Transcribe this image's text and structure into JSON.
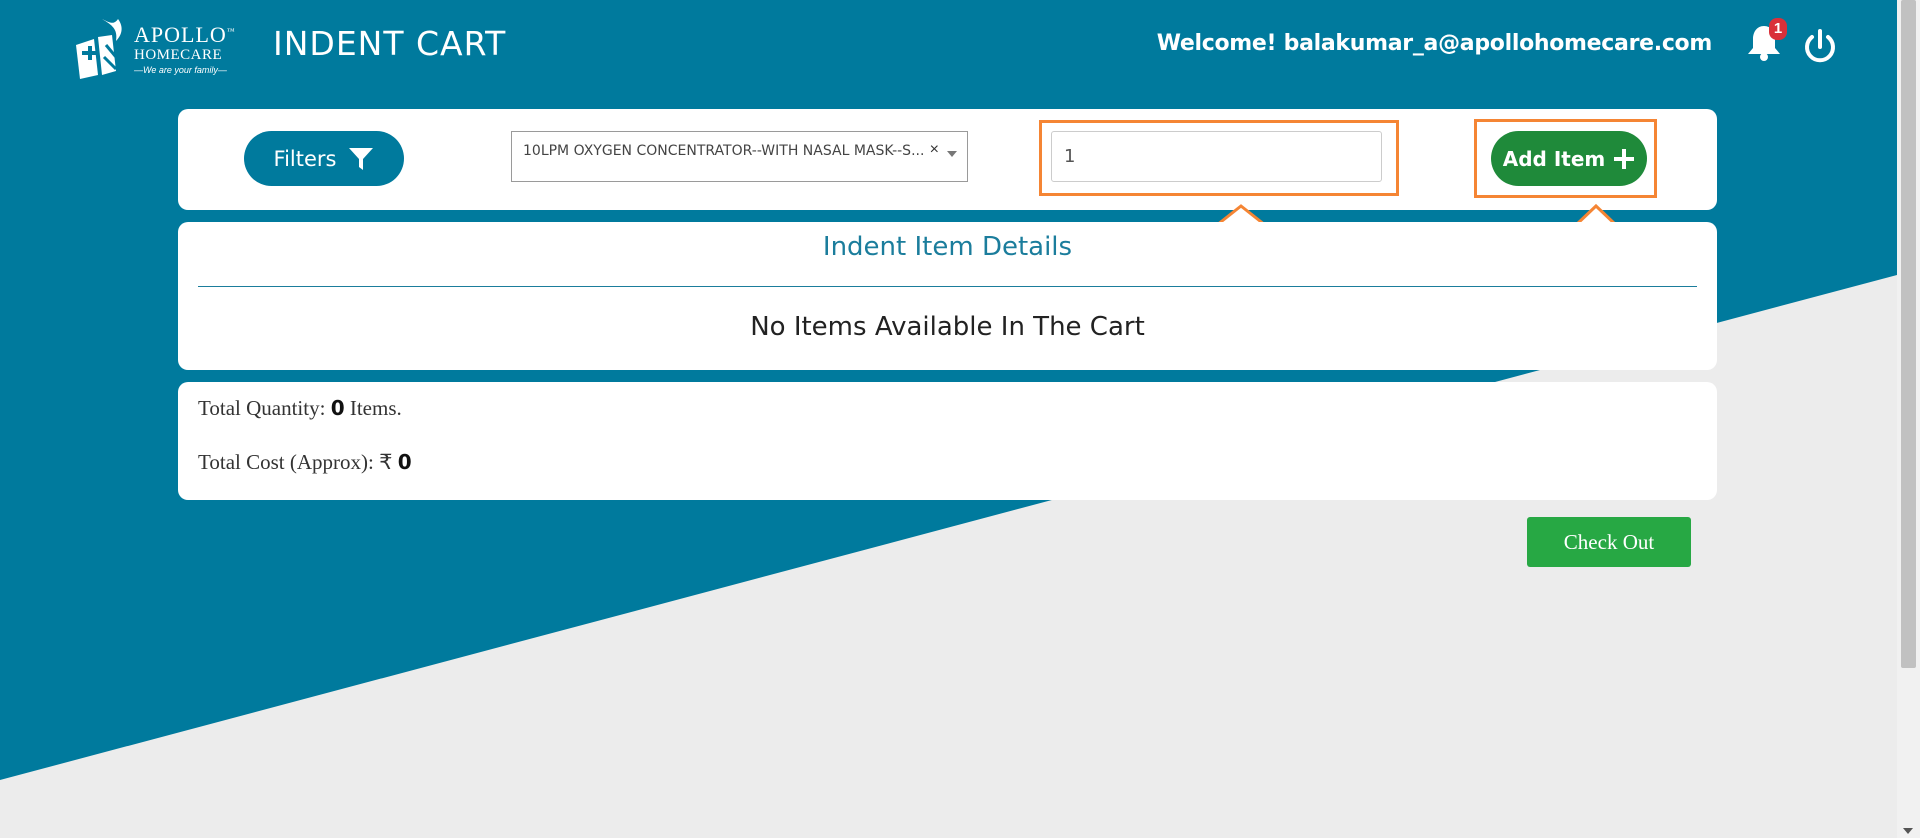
{
  "header": {
    "logo": {
      "name": "APOLLO",
      "tm": "™",
      "sub": "HOMECARE",
      "tagline": "—We are your family—"
    },
    "title": "INDENT CART",
    "welcome": "Welcome! balakumar_a@apollohomecare.com",
    "notification_count": "1"
  },
  "filters": {
    "filters_label": "Filters",
    "selected_item": "10LPM OXYGEN CONCENTRATOR--WITH NASAL MASK--S...",
    "clear_symbol": "×",
    "quantity_value": "1",
    "add_item_label": "Add Item"
  },
  "details": {
    "title": "Indent Item Details",
    "empty_message": "No Items Available In The Cart"
  },
  "totals": {
    "quantity_prefix": "Total Quantity:",
    "quantity_value": "0",
    "quantity_suffix": "Items.",
    "cost_prefix": "Total Cost (Approx):",
    "currency": "₹",
    "cost_value": "0"
  },
  "checkout_label": "Check Out",
  "colors": {
    "brand_teal": "#007a9d",
    "background_grey": "#ececec",
    "add_green": "#1f8a3a",
    "checkout_green": "#27a844",
    "highlight_orange": "#f58534",
    "badge_red": "#d9303a"
  },
  "icons": [
    "filter-icon",
    "plus-icon",
    "bell-icon",
    "power-icon",
    "chevron-down-icon",
    "arrow-up-icon"
  ]
}
